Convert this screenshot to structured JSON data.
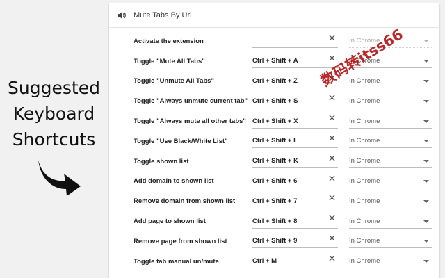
{
  "caption": [
    "Suggested",
    "Keyboard",
    "Shortcuts"
  ],
  "panel": {
    "title": "Mute Tabs By Url",
    "icon": "speaker-icon"
  },
  "rows": [
    {
      "command": "Activate the extension",
      "shortcut": "",
      "scope": "In Chrome",
      "scope_disabled": true
    },
    {
      "command": "Toggle \"Mute All Tabs\"",
      "shortcut": "Ctrl + Shift + A",
      "scope": "In Chrome",
      "scope_disabled": false
    },
    {
      "command": "Toggle \"Unmute All Tabs\"",
      "shortcut": "Ctrl + Shift + Z",
      "scope": "In Chrome",
      "scope_disabled": false
    },
    {
      "command": "Toggle \"Always unmute current tab\"",
      "shortcut": "Ctrl + Shift + S",
      "scope": "In Chrome",
      "scope_disabled": false
    },
    {
      "command": "Toggle \"Always mute all other tabs\"",
      "shortcut": "Ctrl + Shift + X",
      "scope": "In Chrome",
      "scope_disabled": false
    },
    {
      "command": "Toggle \"Use Black/White List\"",
      "shortcut": "Ctrl + Shift + L",
      "scope": "In Chrome",
      "scope_disabled": false
    },
    {
      "command": "Toggle shown list",
      "shortcut": "Ctrl + Shift + K",
      "scope": "In Chrome",
      "scope_disabled": false
    },
    {
      "command": "Add domain to shown list",
      "shortcut": "Ctrl + Shift + 6",
      "scope": "In Chrome",
      "scope_disabled": false
    },
    {
      "command": "Remove domain from shown list",
      "shortcut": "Ctrl + Shift + 7",
      "scope": "In Chrome",
      "scope_disabled": false
    },
    {
      "command": "Add page to shown list",
      "shortcut": "Ctrl + Shift + 8",
      "scope": "In Chrome",
      "scope_disabled": false
    },
    {
      "command": "Remove page from shown list",
      "shortcut": "Ctrl + Shift + 9",
      "scope": "In Chrome",
      "scope_disabled": false
    },
    {
      "command": "Toggle tab manual un/mute",
      "shortcut": "Ctrl + M",
      "scope": "In Chrome",
      "scope_disabled": false
    }
  ],
  "watermark": "数码转itss66",
  "colors": {
    "background": "#f1f1f1",
    "panel": "#ffffff",
    "watermark": "#b51516"
  }
}
